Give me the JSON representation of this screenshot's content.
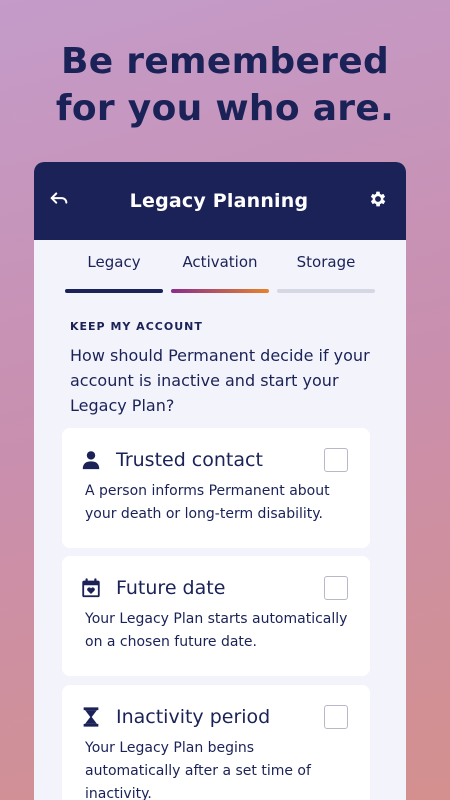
{
  "headline": {
    "line1": "Be remembered",
    "line2": "for you who are."
  },
  "appbar": {
    "title": "Legacy Planning",
    "back_icon": "back-arrow-icon",
    "settings_icon": "gear-icon"
  },
  "tabs": [
    {
      "label": "Legacy",
      "state": "completed"
    },
    {
      "label": "Activation",
      "state": "active"
    },
    {
      "label": "Storage",
      "state": "inactive"
    }
  ],
  "section": {
    "kicker": "KEEP MY ACCOUNT",
    "question": "How should Permanent decide if your account is inactive and start your Legacy Plan?"
  },
  "options": [
    {
      "title": "Trusted contact",
      "icon": "person-icon",
      "description": "A person informs Permanent about your death or long-term disability.",
      "checked": false
    },
    {
      "title": "Future date",
      "icon": "calendar-heart-icon",
      "description": "Your Legacy Plan starts automatically on a chosen future date.",
      "checked": false
    },
    {
      "title": "Inactivity period",
      "icon": "hourglass-icon",
      "description": "Your Legacy Plan begins automatically after a set time of inactivity.",
      "checked": false
    }
  ],
  "colors": {
    "navy": "#1b2257",
    "card_bg": "#ffffff",
    "panel_bg": "#f3f4fb",
    "activation_gradient_start": "#8a2e8a",
    "activation_gradient_end": "#e6832c"
  }
}
